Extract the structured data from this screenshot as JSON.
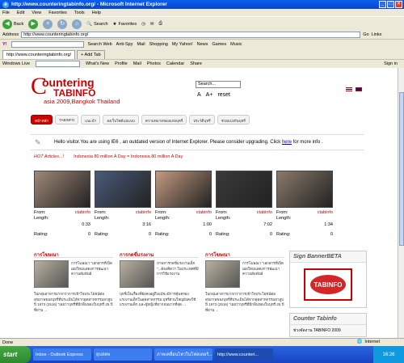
{
  "window": {
    "title": "http://www.counteringtabinfo.org/ - Microsoft Internet Explorer"
  },
  "menu": [
    "File",
    "Edit",
    "View",
    "Favorites",
    "Tools",
    "Help"
  ],
  "toolbar": {
    "back": "Back",
    "search": "Search",
    "favorites": "Favorites"
  },
  "address": {
    "label": "Address",
    "url": "http://www.counteringtabinfo.org/",
    "go": "Go",
    "links": "Links"
  },
  "yahoo": {
    "search_web": "Search Web",
    "antispy": "Anti-Spy",
    "mail": "Mail",
    "shopping": "Shopping",
    "myyahoo": "My Yahoo!",
    "news": "News",
    "games": "Games",
    "music": "Music"
  },
  "tabs": {
    "current": "http://www.counteringtabinfo.org/",
    "add": "Add Tab"
  },
  "live": {
    "label": "Windows Live",
    "whatsnew": "What's New",
    "profile": "Profile",
    "mail": "Mail",
    "photos": "Photos",
    "calendar": "Calendar",
    "share": "Share",
    "signin": "Sign in"
  },
  "site": {
    "logo": {
      "c": "C",
      "ountering": "ountering",
      "tabinfo": "TABINFO",
      "asia": "asia 2009,Bangkok Thailand"
    },
    "search_placeholder": "Search...",
    "font_small": "A",
    "font_large": "A+",
    "font_reset": "reset",
    "nav": [
      "หน้าหลัก",
      "TABINFO",
      "แนะนำ",
      "ลงเว็บไซต์แม่แบบ",
      "ความหมายของแท่งบุหรี่",
      "ประวัติบุหรี่",
      "ช่วยแบ่งกันบุหรี่"
    ],
    "upgrade": {
      "prefix": "Hello visitor.You are using IE6 , an outdated version of Internet Explorer. Please consider upgrading. Click ",
      "link": "here",
      "suffix": " for more info ."
    },
    "hot": {
      "label": "HOT Articles...!",
      "ticker": "Indonesia 80 million A Day = Indonesia 80 million A Day"
    },
    "videos": [
      {
        "from_label": "From:",
        "from": "ctabinfo",
        "length_label": "Length:",
        "length": "0:33",
        "rating_label": "Rating:",
        "rating": "0",
        "thumb_color": "#a08878"
      },
      {
        "from_label": "From:",
        "from": "ctabinfo",
        "length_label": "Length:",
        "length": "3:16",
        "rating_label": "Rating:",
        "rating": "0",
        "thumb_color": "#4a5a7a"
      },
      {
        "from_label": "From:",
        "from": "ctabinfo",
        "length_label": "Length:",
        "length": "1:00",
        "rating_label": "Rating:",
        "rating": "0",
        "thumb_color": "#c49a80"
      },
      {
        "from_label": "From:",
        "from": "ctabinfo",
        "length_label": "Length:",
        "length": "7:02",
        "rating_label": "Rating:",
        "rating": "0",
        "thumb_color": "#3a3a3a"
      },
      {
        "from_label": "From:",
        "from": "ctabinfo",
        "length_label": "Length:",
        "length": "1:34",
        "rating_label": "Rating:",
        "rating": "0",
        "thumb_color": "#8a7a6a"
      }
    ],
    "columns": [
      {
        "title": "การโฆษณา",
        "top": "การโฆษณา \"เอกสารที่เปิดเผยใหม่แสดงการพัฒนาความสัมพันธ์",
        "bottom": "ในกลุ่มอาหารมากกว่าการเข้าใจประโยชน์ต่อสุขภาพของบุหรี่ที่ประเมินได้จากอุตสาหกรรมยาสูบ ปี 1973 (2516) \"เผยว่าบุหรี่ที่มีกลิ่นของใบบุหรี่ 25 ปี ที่ผ่าน ..."
      },
      {
        "title": "การกดขี่แรงงาน",
        "top": "ภาพการกดขี่แรงงานเด็ก \"...ต้องคิดว่า ในประเทศที่มีการใช้แรงงาน",
        "bottom": "บุหรี่เป็นเรื่องที่ยังคงอยู่ถึงแม้จะมีการคุ้มครองแรงงานเด็กในอุตสาหกรรม บุหรี่ส่วนใหญ่ยังคงใช้แรงงานเด็ก และผู้หญิงที่ยากจนมากที่สุด ..."
      },
      {
        "title": "การโฆษณา",
        "top": "การโฆษณา \"เอกสารที่เปิดเผยใหม่แสดงการพัฒนาความสัมพันธ์",
        "bottom": "ในกลุ่มอาหารมากกว่าการเข้าใจประโยชน์ต่อสุขภาพของบุหรี่ที่ประเมินได้จากอุตสาหกรรมยาสูบ ปี 1973 (2516) \"เผยว่าบุหรี่ที่มีกลิ่นของใบบุหรี่ 25 ปี ที่ผ่าน ..."
      }
    ],
    "sign_banner": {
      "title": "Sign BannerBETA",
      "banner_text": "TABINFO"
    },
    "counter": {
      "title": "Counter Tabinfo",
      "line": "ช่วงจัดงาน TABINFO 2009"
    }
  },
  "statusbar": {
    "done": "Done",
    "zone": "Internet"
  },
  "taskbar": {
    "start": "start",
    "tasks": [
      "Inbox - Outlook Express",
      "ยุบสลพ",
      "ภาพเคลื่อนไหวในโฟลเดอร์...",
      "http://www.counteri..."
    ],
    "time": "16:26"
  }
}
